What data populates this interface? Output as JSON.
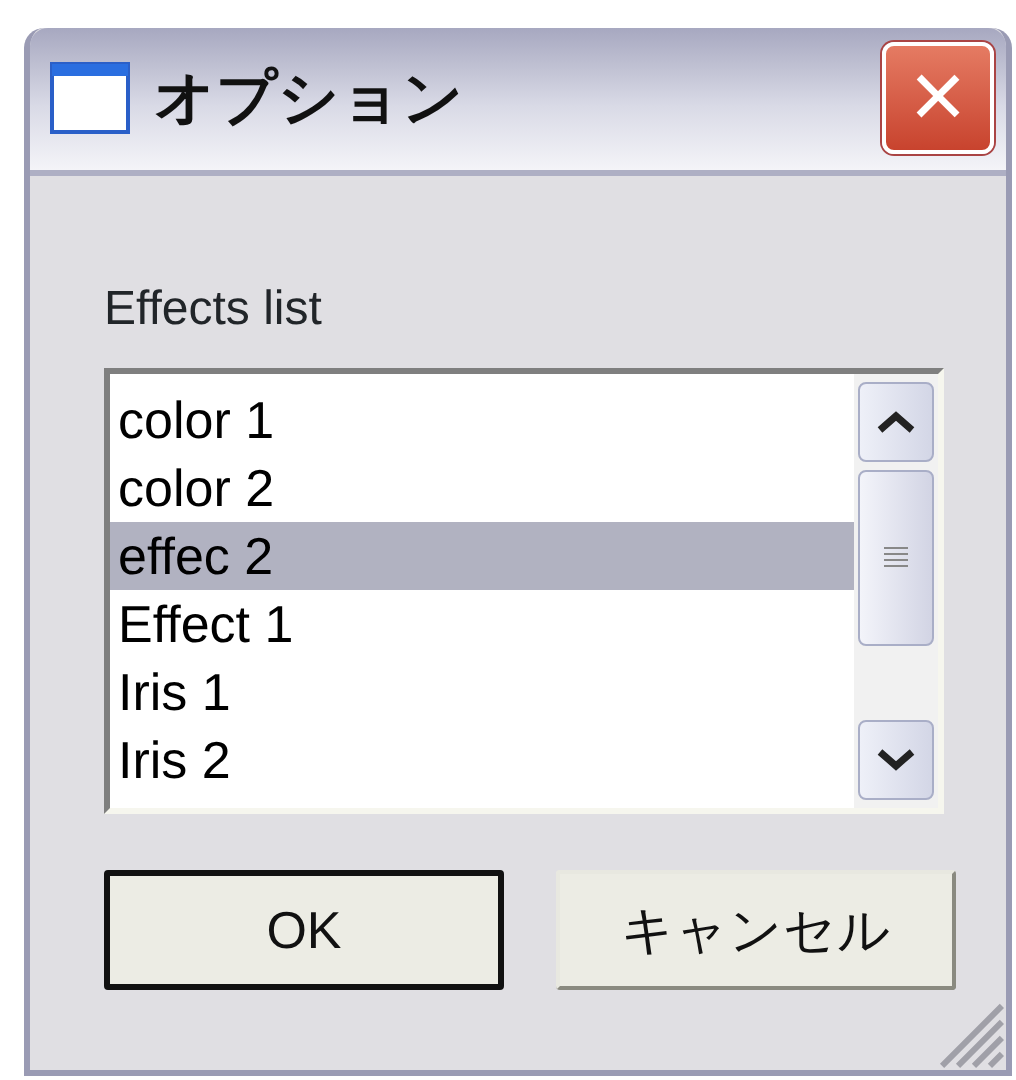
{
  "window": {
    "title": "オプション",
    "close": "×"
  },
  "label": "Effects list",
  "list": {
    "items": [
      {
        "text": "color 1",
        "selected": false
      },
      {
        "text": "color 2",
        "selected": false
      },
      {
        "text": "effec 2",
        "selected": true
      },
      {
        "text": "Effect 1",
        "selected": false
      },
      {
        "text": "Iris 1",
        "selected": false
      },
      {
        "text": "Iris 2",
        "selected": false
      }
    ]
  },
  "buttons": [
    {
      "label": "OK",
      "default": true
    },
    {
      "label": "キャンセル",
      "default": false
    }
  ]
}
